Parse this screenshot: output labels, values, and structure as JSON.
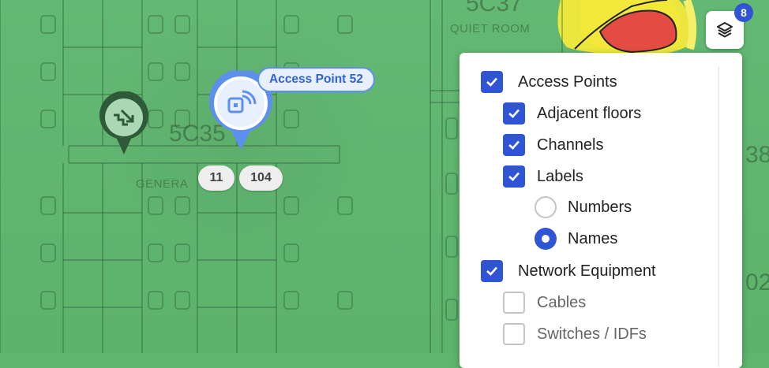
{
  "map": {
    "rooms": [
      {
        "number": "5C37",
        "name": "QUIET ROOM"
      },
      {
        "number": "5C35",
        "name": "GENERA"
      },
      {
        "number": "38",
        "name": ""
      },
      {
        "number": "02",
        "name": ""
      }
    ],
    "access_point": {
      "label": "Access Point 52",
      "icon": "wifi-square-icon",
      "chips": [
        "11",
        "104"
      ]
    },
    "other_marker": {
      "icon": "stairs-icon"
    },
    "heatmap_colors": {
      "base": "#5fb46e",
      "mid": "#f2e83a",
      "hot": "#e44b43"
    }
  },
  "layers_button": {
    "icon": "layers-icon",
    "badge": "8"
  },
  "panel": {
    "items": [
      {
        "label": "Access Points",
        "type": "checkbox",
        "checked": true
      },
      {
        "label": "Adjacent floors",
        "type": "checkbox",
        "checked": true
      },
      {
        "label": "Channels",
        "type": "checkbox",
        "checked": true
      },
      {
        "label": "Labels",
        "type": "checkbox",
        "checked": true
      },
      {
        "label": "Numbers",
        "type": "radio",
        "checked": false
      },
      {
        "label": "Names",
        "type": "radio",
        "checked": true
      },
      {
        "label": "Network Equipment",
        "type": "checkbox",
        "checked": true
      },
      {
        "label": "Cables",
        "type": "checkbox",
        "checked": false
      },
      {
        "label": "Switches / IDFs",
        "type": "checkbox",
        "checked": false
      }
    ]
  },
  "colors": {
    "accent": "#2f55d4",
    "ap_blue": "#5d8ff0",
    "marker_green": "#2f5a3a"
  }
}
